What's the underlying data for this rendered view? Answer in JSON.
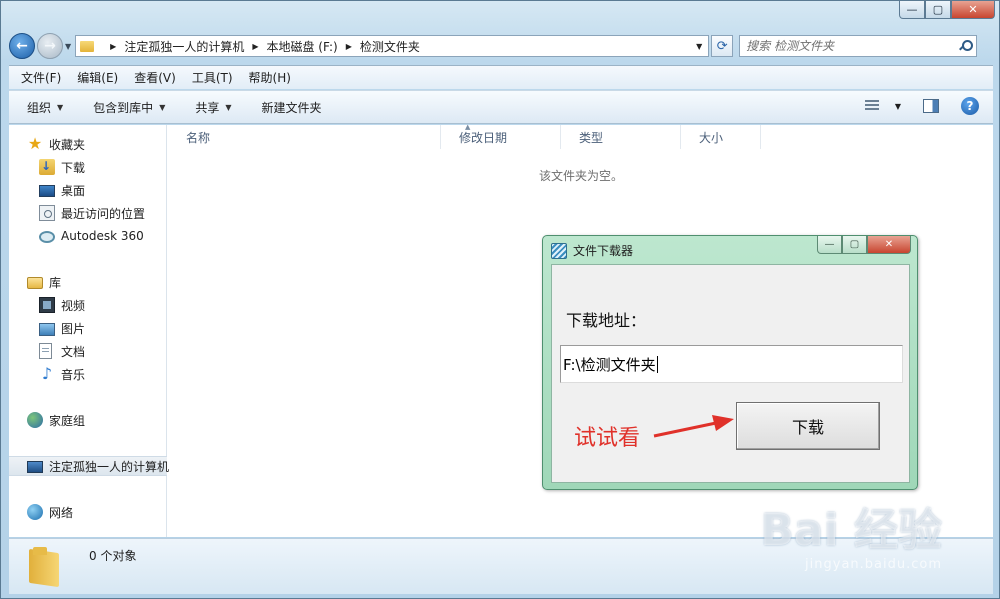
{
  "window": {
    "caption_buttons": [
      "—",
      "▢",
      "✕"
    ]
  },
  "address": {
    "crumbs": [
      "注定孤独一人的计算机",
      "本地磁盘 (F:)",
      "检测文件夹"
    ]
  },
  "search": {
    "placeholder": "搜索 检测文件夹"
  },
  "menu": [
    "文件(F)",
    "编辑(E)",
    "查看(V)",
    "工具(T)",
    "帮助(H)"
  ],
  "toolbar": [
    "组织",
    "包含到库中",
    "共享",
    "新建文件夹"
  ],
  "nav": {
    "favorites": "收藏夹",
    "downloads": "下载",
    "desktop": "桌面",
    "recent": "最近访问的位置",
    "autodesk": "Autodesk 360",
    "libraries": "库",
    "videos": "视频",
    "pictures": "图片",
    "documents": "文档",
    "music": "音乐",
    "homegroup": "家庭组",
    "computer": "注定孤独一人的计算机",
    "network": "网络"
  },
  "columns": [
    "名称",
    "修改日期",
    "类型",
    "大小"
  ],
  "empty_message": "该文件夹为空。",
  "status": {
    "count": "0 个对象"
  },
  "dialog": {
    "title": "文件下载器",
    "label": "下载地址：",
    "input_value": "F:\\检测文件夹",
    "button": "下载",
    "annotation": "试试看"
  },
  "watermark": {
    "brand": "Bai 经验",
    "url": "jingyan.baidu.com"
  },
  "colors": {
    "annotation": "#e0312a",
    "dialog_frame": "#9fd7b8"
  }
}
